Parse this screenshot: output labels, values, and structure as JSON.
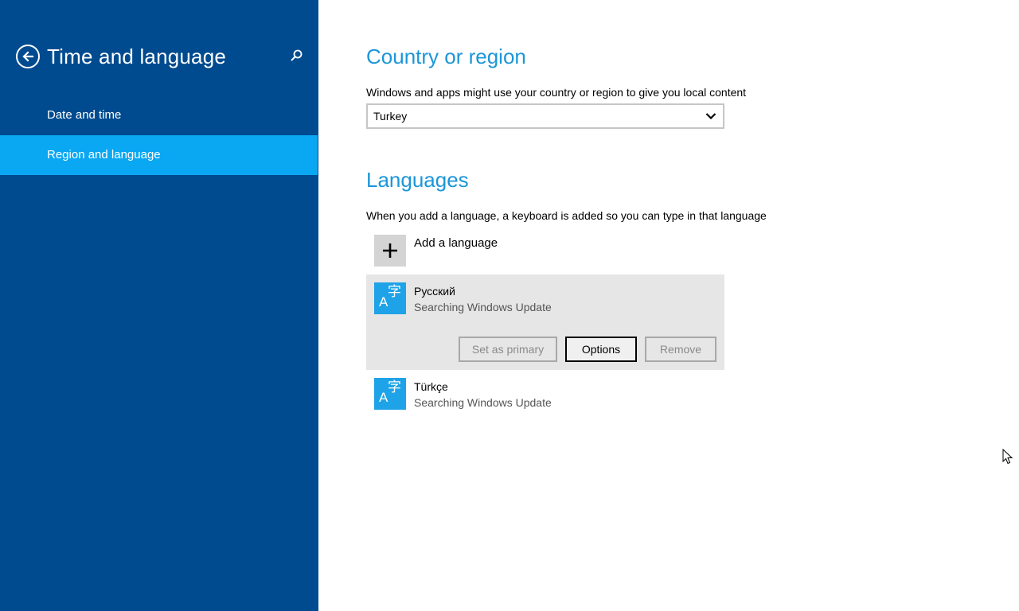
{
  "sidebar": {
    "title": "Time and language",
    "items": [
      {
        "label": "Date and time",
        "selected": false
      },
      {
        "label": "Region and language",
        "selected": true
      }
    ]
  },
  "country": {
    "heading": "Country or region",
    "description": "Windows and apps might use your country or region to give you local content",
    "selected_value": "Turkey"
  },
  "languages": {
    "heading": "Languages",
    "description": "When you add a language, a keyboard is added so you can type in that language",
    "add_label": "Add a language",
    "list": [
      {
        "name": "Русский",
        "status": "Searching Windows Update",
        "expanded": true
      },
      {
        "name": "Türkçe",
        "status": "Searching Windows Update",
        "expanded": false
      }
    ],
    "buttons": {
      "set_primary": "Set as primary",
      "options": "Options",
      "remove": "Remove"
    }
  },
  "icons": {
    "back": "back-arrow-icon",
    "search": "search-icon",
    "chevron": "chevron-down-icon",
    "add": "plus-icon",
    "language": "language-icon",
    "language_glyph_latin": "A",
    "language_glyph_cjk": "字"
  },
  "colors": {
    "sidebar_bg": "#004b8f",
    "selected_item": "#0aa7f2",
    "heading": "#1b96d8",
    "language_tile": "#1fa3e8"
  }
}
